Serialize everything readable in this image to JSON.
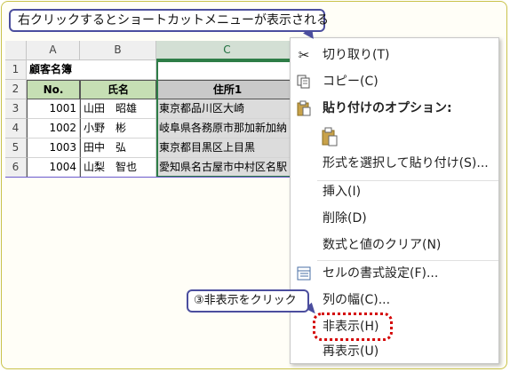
{
  "callout_top": "右クリックするとショートカットメニューが表示される",
  "callout_step": "③非表示をクリック",
  "sheet": {
    "columns": [
      "A",
      "B",
      "C"
    ],
    "rows": [
      "1",
      "2",
      "3",
      "4",
      "5",
      "6"
    ],
    "title": "顧客名簿",
    "headers": {
      "no": "No.",
      "name": "氏名",
      "address": "住所1"
    },
    "records": [
      {
        "no": "1001",
        "name": "山田　昭雄",
        "address": "東京都品川区大崎"
      },
      {
        "no": "1002",
        "name": "小野　彬",
        "address": "岐阜県各務原市那加新加納"
      },
      {
        "no": "1003",
        "name": "田中　弘",
        "address": "東京都目黒区上目黒"
      },
      {
        "no": "1004",
        "name": "山梨　智也",
        "address": "愛知県名古屋市中村区名駅"
      }
    ]
  },
  "menu": {
    "cut": "切り取り(T)",
    "copy": "コピー(C)",
    "paste_options": "貼り付けのオプション:",
    "paste_special": "形式を選択して貼り付け(S)...",
    "insert": "挿入(I)",
    "delete": "削除(D)",
    "clear": "数式と値のクリア(N)",
    "format_cells": "セルの書式設定(F)...",
    "column_width": "列の幅(C)...",
    "hide": "非表示(H)",
    "unhide": "再表示(U)"
  },
  "icons": {
    "cut": "scissors-icon",
    "copy": "copy-icon",
    "paste": "clipboard-icon",
    "format": "format-cells-icon"
  },
  "colors": {
    "header_green": "#c6dfb4",
    "selected_col": "#2e7d47",
    "callout_border": "#4b4e9e",
    "highlight": "#d40000"
  }
}
